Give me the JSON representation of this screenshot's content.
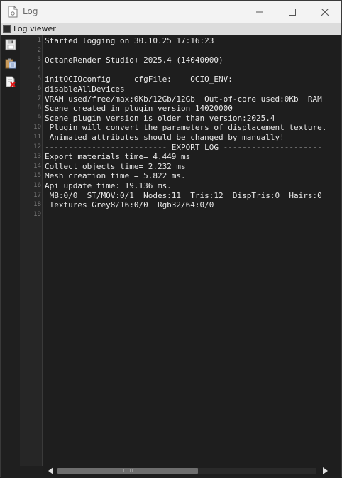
{
  "window": {
    "title": "Log",
    "app_icon": "document-icon",
    "controls": [
      "minimize-icon",
      "maximize-icon",
      "close-icon"
    ]
  },
  "viewer_bar": {
    "label": "Log viewer"
  },
  "toolbar": {
    "items": [
      {
        "name": "save-log",
        "icon": "floppy-disk-icon"
      },
      {
        "name": "copy-log",
        "icon": "clipboard-icon"
      },
      {
        "name": "clear-log",
        "icon": "clear-document-icon"
      }
    ]
  },
  "log": {
    "line_numbers": [
      "1",
      "2",
      "3",
      "4",
      "5",
      "6",
      "7",
      "8",
      "9",
      "10",
      "11",
      "12",
      "13",
      "14",
      "15",
      "16",
      "17",
      "18",
      "19"
    ],
    "lines": [
      "Started logging on 30.10.25 17:16:23",
      "",
      "OctaneRender Studio+ 2025.4 (14040000)",
      "",
      "initOCIOconfig     cfgFile:    OCIO_ENV:",
      "disableAllDevices",
      "VRAM used/free/max:0Kb/12Gb/12Gb  Out-of-core used:0Kb  RAM",
      "Scene created in plugin version 14020000",
      "Scene plugin version is older than version:2025.4",
      " Plugin will convert the parameters of displacement texture.",
      " Animated attributes should be changed by manually!",
      "-------------------------- EXPORT LOG ---------------------",
      "Export materials time= 4.449 ms",
      "Collect objects time= 2.232 ms",
      "Mesh creation time = 5.822 ms.",
      "Api update time: 19.136 ms.",
      " MB:0/0  ST/MOV:0/1  Nodes:11  Tris:12  DispTris:0  Hairs:0",
      " Textures Grey8/16:0/0  Rgb32/64:0/0",
      ""
    ]
  },
  "colors": {
    "background": "#1e1e1e",
    "titlebar": "#f3f3f3",
    "text": "#e8e8e8",
    "line_numbers": "#777777"
  }
}
